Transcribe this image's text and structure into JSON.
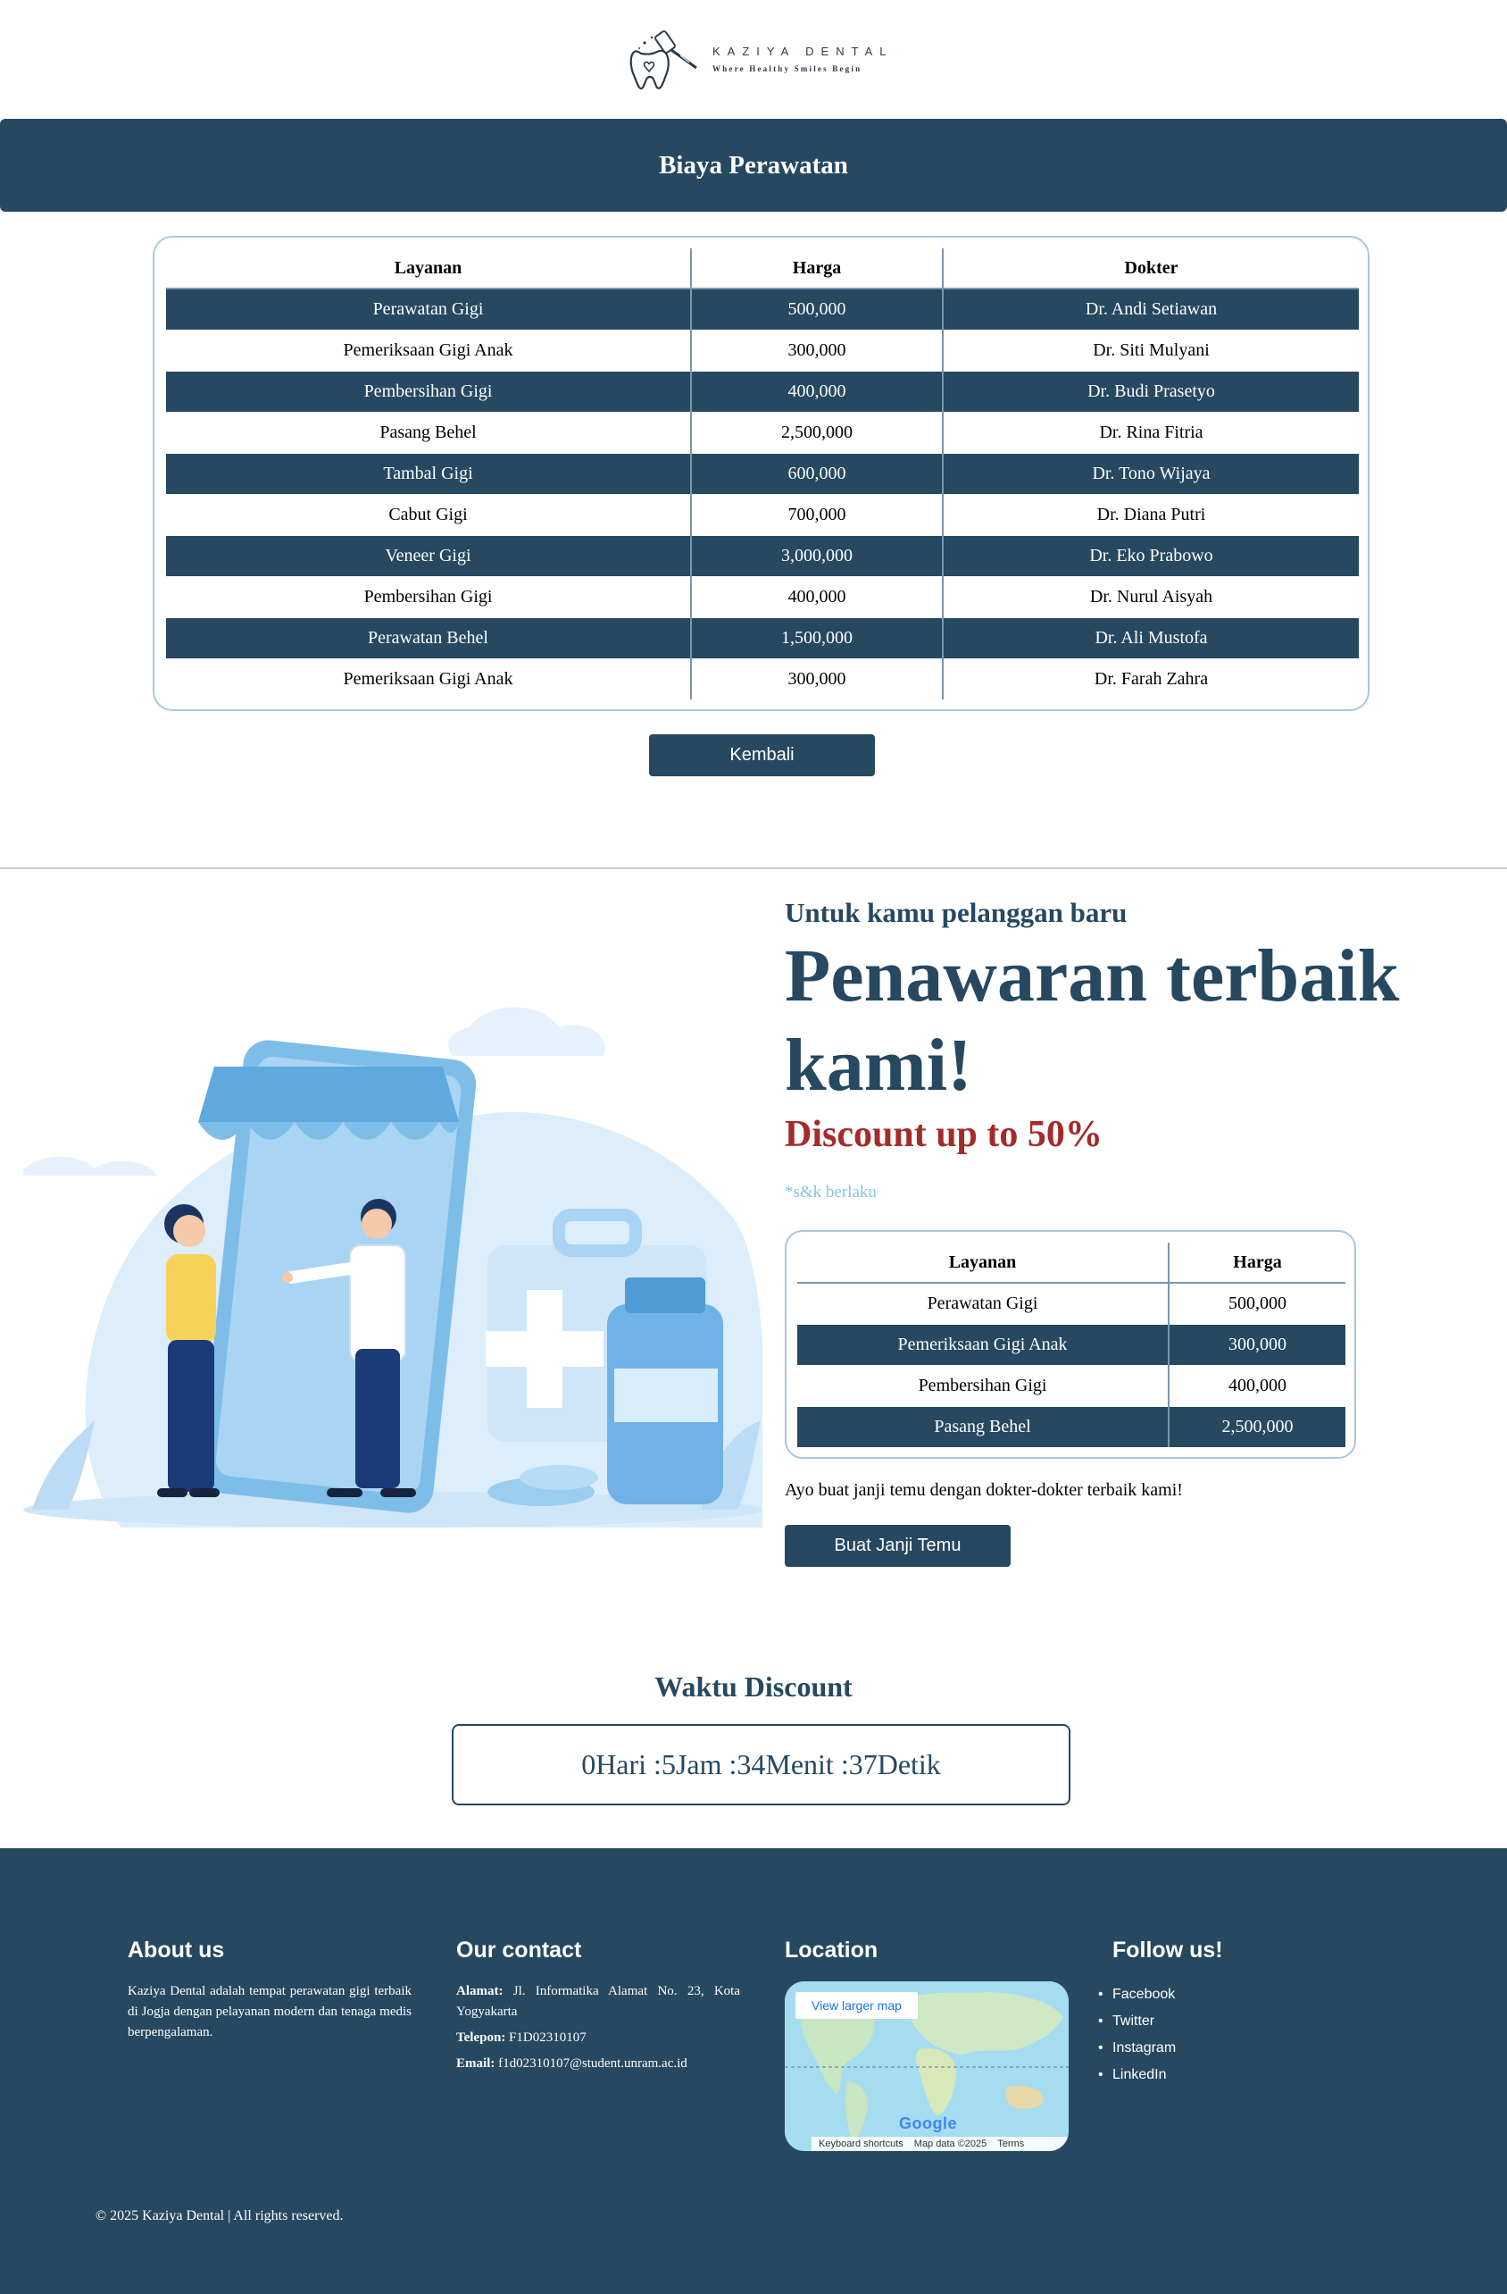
{
  "header": {
    "brand": "KAZIYA DENTAL",
    "tagline": "Where Healthy Smiles Begin"
  },
  "pricing": {
    "title": "Biaya Perawatan",
    "columns": [
      "Layanan",
      "Harga",
      "Dokter"
    ],
    "rows": [
      [
        "Perawatan Gigi",
        "500,000",
        "Dr. Andi Setiawan"
      ],
      [
        "Pemeriksaan Gigi Anak",
        "300,000",
        "Dr. Siti Mulyani"
      ],
      [
        "Pembersihan Gigi",
        "400,000",
        "Dr. Budi Prasetyo"
      ],
      [
        "Pasang Behel",
        "2,500,000",
        "Dr. Rina Fitria"
      ],
      [
        "Tambal Gigi",
        "600,000",
        "Dr. Tono Wijaya"
      ],
      [
        "Cabut Gigi",
        "700,000",
        "Dr. Diana Putri"
      ],
      [
        "Veneer Gigi",
        "3,000,000",
        "Dr. Eko Prabowo"
      ],
      [
        "Pembersihan Gigi",
        "400,000",
        "Dr. Nurul Aisyah"
      ],
      [
        "Perawatan Behel",
        "1,500,000",
        "Dr. Ali Mustofa"
      ],
      [
        "Pemeriksaan Gigi Anak",
        "300,000",
        "Dr. Farah Zahra"
      ]
    ],
    "back_button": "Kembali"
  },
  "promo": {
    "subtitle": "Untuk kamu pelanggan baru",
    "title": "Penawaran terbaik kami!",
    "discount": "Discount up to 50%",
    "note": "*s&k berlaku",
    "columns": [
      "Layanan",
      "Harga"
    ],
    "rows": [
      [
        "Perawatan Gigi",
        "500,000"
      ],
      [
        "Pemeriksaan Gigi Anak",
        "300,000"
      ],
      [
        "Pembersihan Gigi",
        "400,000"
      ],
      [
        "Pasang Behel",
        "2,500,000"
      ]
    ],
    "cta_text": "Ayo buat janji temu dengan dokter-dokter terbaik kami!",
    "cta_button": "Buat Janji Temu"
  },
  "countdown": {
    "title": "Waktu Discount",
    "value": "0Hari :5Jam :34Menit :37Detik"
  },
  "footer": {
    "about": {
      "title": "About us",
      "text": "Kaziya Dental adalah tempat perawatan gigi terbaik di Jogja dengan pelayanan modern dan tenaga medis berpengalaman."
    },
    "contact": {
      "title": "Our contact",
      "address_label": "Alamat:",
      "address": "Jl. Informatika Alamat No. 23, Kota Yogyakarta",
      "phone_label": "Telepon:",
      "phone": "F1D02310107",
      "email_label": "Email:",
      "email": "f1d02310107@student.unram.ac.id"
    },
    "location": {
      "title": "Location",
      "map_link": "View larger map",
      "map_logo": "Google",
      "map_attr": [
        "Keyboard shortcuts",
        "Map data ©2025",
        "Terms"
      ]
    },
    "follow": {
      "title": "Follow us!",
      "links": [
        "Facebook",
        "Twitter",
        "Instagram",
        "LinkedIn"
      ]
    },
    "copyright": "© 2025 Kaziya Dental | All rights reserved."
  },
  "colors": {
    "primary": "#264861",
    "accent_red": "#a52a2a",
    "light_blue": "#86c3e3",
    "card_border": "#a9c8dd"
  }
}
